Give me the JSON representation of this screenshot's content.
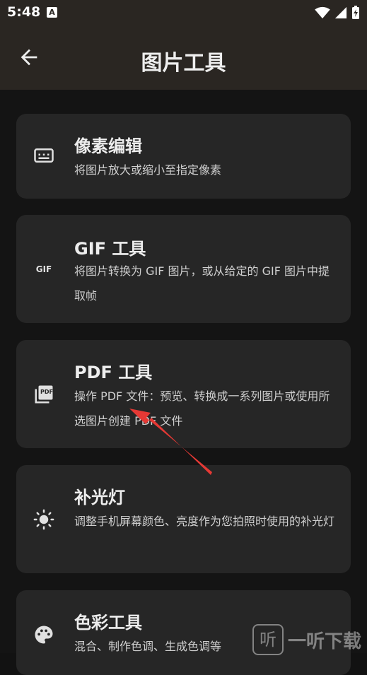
{
  "status": {
    "time": "5:48",
    "a_icon": "A"
  },
  "appbar": {
    "title": "图片工具"
  },
  "tools": [
    {
      "title": "像素编辑",
      "description": "将图片放大或缩小至指定像素",
      "icon": "pixel-editor-icon"
    },
    {
      "title": "GIF 工具",
      "description": "将图片转换为 GIF 图片，或从给定的 GIF 图片中提取帧",
      "icon": "gif-icon",
      "icon_text": "GIF"
    },
    {
      "title": "PDF 工具",
      "description": "操作 PDF 文件：预览、转换成一系列图片或使用所选图片创建 PDF 文件",
      "icon": "pdf-icon",
      "icon_text": "PDF"
    },
    {
      "title": "补光灯",
      "description": "调整手机屏幕颜色、亮度作为您拍照时使用的补光灯",
      "icon": "brightness-icon"
    },
    {
      "title": "色彩工具",
      "description": "混合、制作色调、生成色调等",
      "icon": "palette-icon"
    }
  ],
  "watermark": {
    "box": "听",
    "text": "一听下载"
  },
  "colors": {
    "appbar": "#2a2622",
    "card": "#262626",
    "background": "#141414",
    "arrow": "#e53935"
  }
}
